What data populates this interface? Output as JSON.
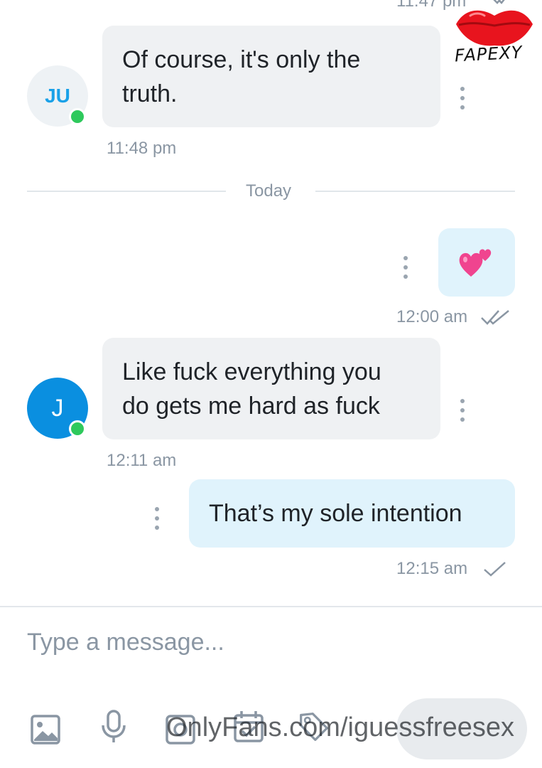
{
  "thread": {
    "top_time": "11:47 pm",
    "watermark_text": "FAPEXY",
    "day_divider": "Today"
  },
  "messages": [
    {
      "direction": "in",
      "avatar": "JU",
      "text": "Of course, it's only the\ntruth.",
      "time": "11:48 pm"
    },
    {
      "direction": "out",
      "text": "💕",
      "time": "12:00 am",
      "status": "read"
    },
    {
      "direction": "in",
      "avatar": "J",
      "text": "Like fuck everything you\ndo gets me hard as fuck",
      "time": "12:11 am"
    },
    {
      "direction": "out",
      "text": "That’s my sole intention",
      "time": "12:15 am",
      "status": "sent"
    }
  ],
  "composer": {
    "placeholder": "Type a message...",
    "tools": [
      "image-icon",
      "microphone-icon",
      "camera-icon",
      "calendar-icon",
      "price-tag-icon"
    ],
    "url_watermark": "OnlyFans.com/iguessfreesex"
  },
  "colors": {
    "incoming_bubble": "#eff1f3",
    "outgoing_bubble": "#e0f3fc",
    "accent_blue": "#0a8fe0",
    "online": "#2ec95c"
  }
}
